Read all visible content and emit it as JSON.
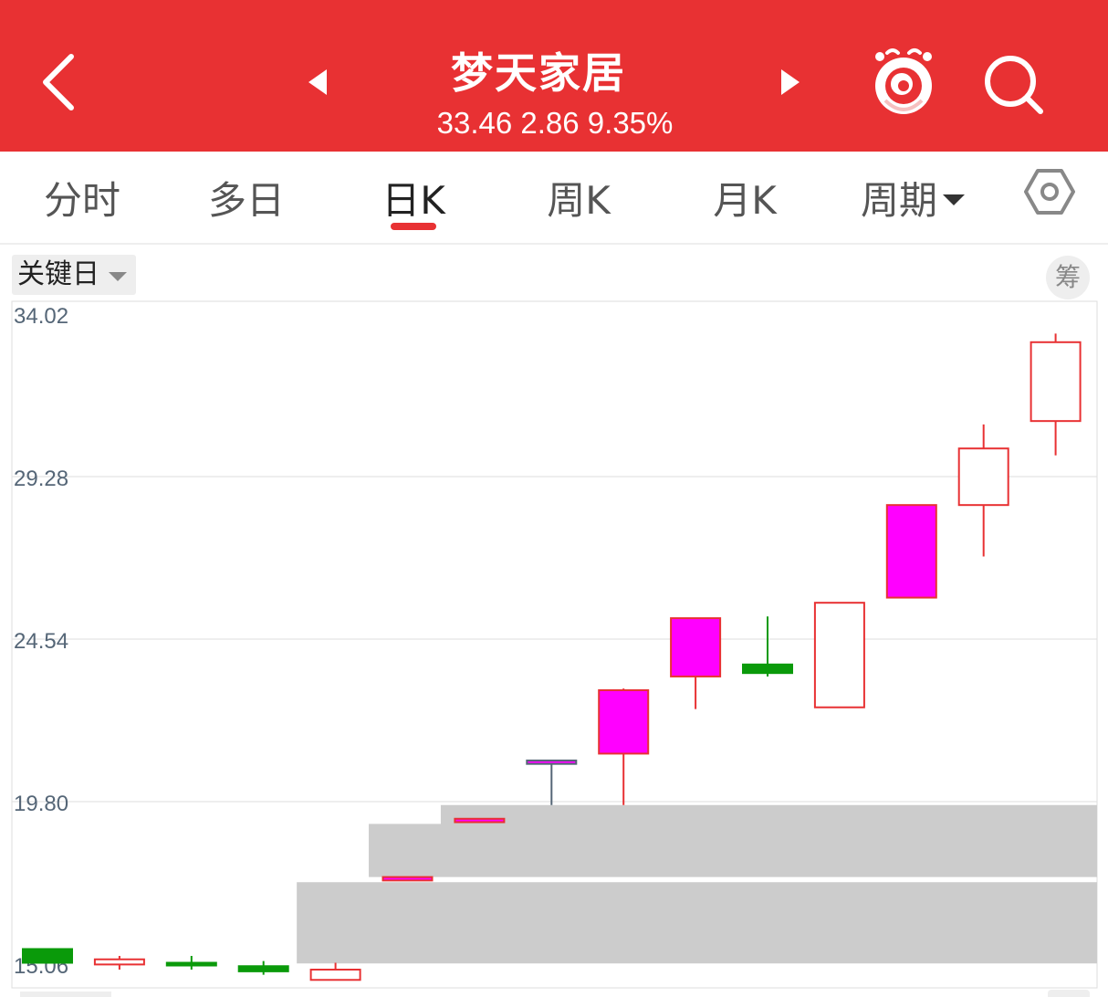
{
  "header": {
    "stock_name": "梦天家居",
    "price": "33.46",
    "change": "2.86",
    "change_pct": "9.35%",
    "background": "#e83133"
  },
  "tabs": [
    {
      "label": "分时"
    },
    {
      "label": "多日"
    },
    {
      "label": "日K",
      "active": true
    },
    {
      "label": "周K"
    },
    {
      "label": "月K"
    },
    {
      "label": "周期"
    }
  ],
  "toolbar": {
    "key_day_label": "关键日",
    "chips_label": "筹"
  },
  "icons": {
    "back": "chevron-left-icon",
    "prev": "triangle-left-icon",
    "next": "triangle-right-icon",
    "mascot": "mascot-icon",
    "search": "search-icon",
    "settings": "hexagon-settings-icon"
  },
  "chart_data": {
    "type": "candlestick",
    "y_ticks": [
      "34.02",
      "29.28",
      "24.54",
      "19.80",
      "15.06"
    ],
    "ylim": [
      15.06,
      34.02
    ],
    "grid": true,
    "colors": {
      "up": "#e83133",
      "down": "#0a9a0a",
      "limit_up_fill": "#ff00ff",
      "volume_profile": "#cccccc"
    },
    "candles": [
      {
        "open": 15.5,
        "close": 15.1,
        "high": 15.4,
        "low": 15.1,
        "kind": "down"
      },
      {
        "open": 15.05,
        "close": 15.2,
        "high": 15.3,
        "low": 14.9,
        "kind": "up"
      },
      {
        "open": 15.1,
        "close": 15.05,
        "high": 15.3,
        "low": 14.9,
        "kind": "down"
      },
      {
        "open": 15.0,
        "close": 14.85,
        "high": 15.15,
        "low": 14.75,
        "kind": "down"
      },
      {
        "open": 14.6,
        "close": 14.9,
        "high": 15.1,
        "low": 14.6,
        "kind": "up"
      },
      {
        "open": 17.5,
        "close": 17.6,
        "high": 17.6,
        "low": 17.5,
        "kind": "limit"
      },
      {
        "open": 19.2,
        "close": 19.3,
        "high": 19.3,
        "low": 19.2,
        "kind": "limit"
      },
      {
        "open": 20.9,
        "close": 21.0,
        "high": 21.0,
        "low": 19.7,
        "kind": "limit"
      },
      {
        "open": 21.2,
        "close": 23.05,
        "high": 23.1,
        "low": 19.7,
        "kind": "limit"
      },
      {
        "open": 23.45,
        "close": 25.15,
        "high": 25.15,
        "low": 22.5,
        "kind": "limit"
      },
      {
        "open": 23.55,
        "close": 23.8,
        "high": 25.2,
        "low": 23.45,
        "kind": "down"
      },
      {
        "open": 22.55,
        "close": 25.6,
        "high": 25.6,
        "low": 22.55,
        "kind": "up"
      },
      {
        "open": 25.75,
        "close": 28.45,
        "high": 28.45,
        "low": 25.75,
        "kind": "limit"
      },
      {
        "open": 28.45,
        "close": 30.1,
        "high": 30.8,
        "low": 26.95,
        "kind": "up"
      },
      {
        "open": 30.9,
        "close": 33.2,
        "high": 33.45,
        "low": 29.9,
        "kind": "up"
      }
    ],
    "volume_profile_bands": [
      {
        "low": 19.05,
        "high": 19.7,
        "start_index": 6
      },
      {
        "low": 17.6,
        "high": 19.15,
        "start_index": 5
      },
      {
        "low": 15.08,
        "high": 17.45,
        "start_index": 4
      }
    ]
  }
}
